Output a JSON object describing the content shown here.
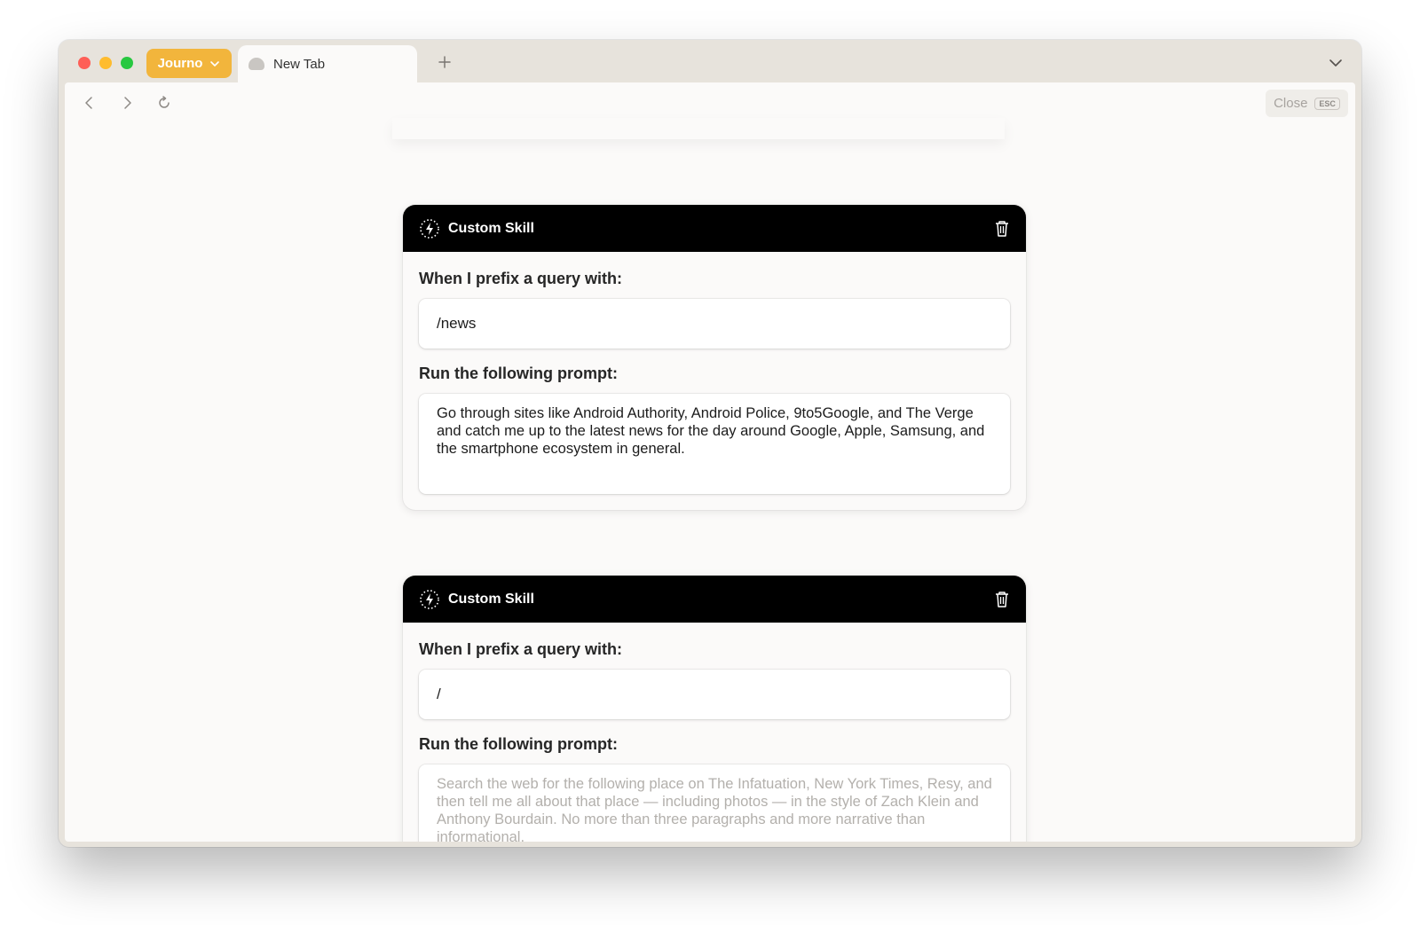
{
  "browser": {
    "space_label": "Journo",
    "tab_title": "New Tab",
    "close_label": "Close",
    "close_shortcut": "ESC"
  },
  "cards": [
    {
      "title": "Custom Skill",
      "prefix_label": "When I prefix a query with:",
      "prefix_value": "/news",
      "prompt_label": "Run the following prompt:",
      "prompt_value": "Go through sites like Android Authority, Android Police, 9to5Google, and The Verge and catch me up to the latest news for the day around Google, Apple, Samsung, and the smartphone ecosystem in general.",
      "prompt_placeholder": ""
    },
    {
      "title": "Custom Skill",
      "prefix_label": "When I prefix a query with:",
      "prefix_value": "/",
      "prompt_label": "Run the following prompt:",
      "prompt_value": "",
      "prompt_placeholder": "Search the web for the following place on The Infatuation, New York Times, Resy, and then tell me all about that place — including photos — in the style of Zach Klein and Anthony Bourdain. No more than three paragraphs and more narrative than informational."
    }
  ],
  "colors": {
    "space_accent": "#f2b53c",
    "card_header": "#000000"
  },
  "icons": {
    "back": "chevron-left-icon",
    "forward": "chevron-right-icon",
    "reload": "reload-icon",
    "skill": "lightning-bolt-icon",
    "delete": "trash-icon"
  }
}
